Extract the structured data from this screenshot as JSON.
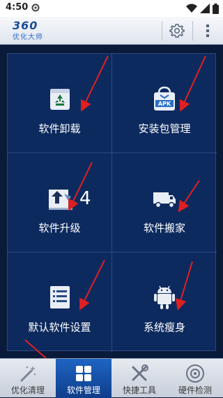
{
  "status_bar": {
    "time": "4:50"
  },
  "app_bar": {
    "logo_top": "360",
    "logo_bottom": "优化大师"
  },
  "grid": {
    "items": [
      {
        "label": "软件卸载"
      },
      {
        "label": "安装包管理",
        "icon_text": "APK"
      },
      {
        "label": "软件升级",
        "badge": "4"
      },
      {
        "label": "软件搬家"
      },
      {
        "label": "默认软件设置"
      },
      {
        "label": "系统瘦身"
      }
    ]
  },
  "tabs": [
    {
      "label": "优化清理",
      "active": false
    },
    {
      "label": "软件管理",
      "active": true
    },
    {
      "label": "快捷工具",
      "active": false
    },
    {
      "label": "硬件检测",
      "active": false
    }
  ],
  "colors": {
    "accent": "#1e64c3",
    "grid_bg": "#0d2a5f",
    "arrow": "#e02020"
  }
}
